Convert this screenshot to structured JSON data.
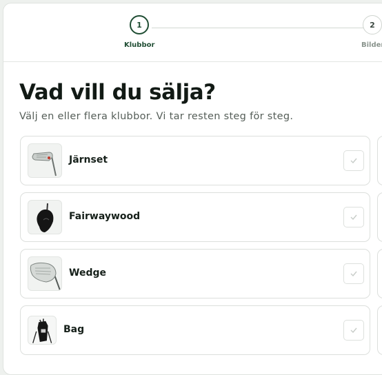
{
  "stepper": {
    "steps": [
      {
        "number": "1",
        "label": "Klubbor"
      },
      {
        "number": "2",
        "label": "Bilder"
      }
    ]
  },
  "main": {
    "title": "Vad vill du sälja?",
    "subtitle": "Välj en eller flera klubbor. Vi tar resten steg för steg."
  },
  "options": [
    {
      "label": "Järnset",
      "icon": "iron-club-icon"
    },
    {
      "label": "Fairwaywood",
      "icon": "fairway-wood-icon"
    },
    {
      "label": "Wedge",
      "icon": "wedge-club-icon"
    },
    {
      "label": "Bag",
      "icon": "golf-bag-icon"
    }
  ],
  "colors": {
    "accent": "#1f4d33",
    "border": "#dcdfdc",
    "background": "#eef1ee"
  }
}
